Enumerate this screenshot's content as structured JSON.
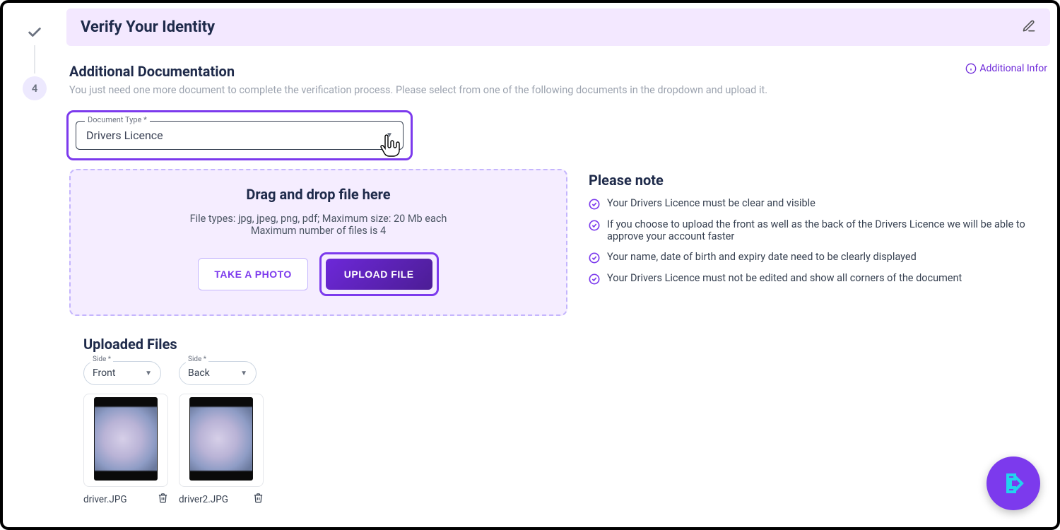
{
  "header": {
    "title": "Verify Your Identity",
    "step_number": "4"
  },
  "section": {
    "title": "Additional Documentation",
    "description": "You just need one more document to complete the verification process. Please select from one of the following documents in the dropdown and upload it.",
    "additional_info_label": "Additional Infor"
  },
  "doc_type": {
    "label": "Document Type *",
    "value": "Drivers Licence"
  },
  "dropzone": {
    "title": "Drag and drop file here",
    "line1": "File types: jpg, jpeg, png, pdf; Maximum size: 20 Mb each",
    "line2": "Maximum number of files is 4",
    "take_photo": "TAKE A PHOTO",
    "upload_file": "UPLOAD FILE"
  },
  "notes": {
    "title": "Please note",
    "items": [
      "Your Drivers Licence must be clear and visible",
      "If you choose to upload the front as well as the back of the Drivers Licence we will be able to approve your account faster",
      "Your name, date of birth and expiry date need to be clearly displayed",
      "Your Drivers Licence must not be edited and show all corners of the document"
    ]
  },
  "uploaded": {
    "title": "Uploaded Files",
    "side_label": "Side *",
    "files": [
      {
        "side": "Front",
        "name": "driver.JPG"
      },
      {
        "side": "Back",
        "name": "driver2.JPG"
      }
    ]
  }
}
